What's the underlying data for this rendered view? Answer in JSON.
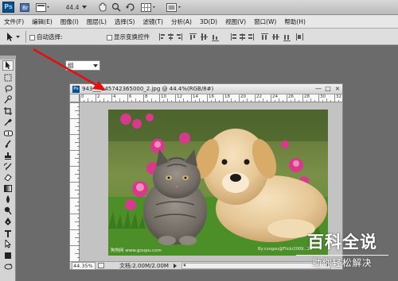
{
  "app": {
    "logo": "Ps"
  },
  "topbar": {
    "zoom_value": "44.4",
    "icons": [
      "bridge-icon",
      "mini-bridge-icon",
      "zoom-dropdown-icon",
      "hand-icon",
      "zoom-icon",
      "rotate-icon",
      "grid-icon",
      "screen-mode-icon"
    ]
  },
  "menus": [
    "文件(F)",
    "编辑(E)",
    "图像(I)",
    "图层(L)",
    "选择(S)",
    "滤镜(T)",
    "分析(A)",
    "3D(D)",
    "视图(V)",
    "窗口(W)",
    "帮助(H)"
  ],
  "options": {
    "auto_select_label": "自动选择:",
    "auto_select_checked": false,
    "layer_select_value": "组",
    "show_transform_label": "显示变换控件",
    "show_transform_checked": false
  },
  "tools": [
    "move-tool-icon",
    "marquee-tool-icon",
    "lasso-tool-icon",
    "quick-select-tool-icon",
    "crop-tool-icon",
    "eyedropper-tool-icon",
    "healing-brush-tool-icon",
    "brush-tool-icon",
    "clone-stamp-tool-icon",
    "history-brush-tool-icon",
    "eraser-tool-icon",
    "gradient-tool-icon",
    "blur-tool-icon",
    "dodge-tool-icon",
    "pen-tool-icon",
    "type-tool-icon",
    "path-selection-tool-icon",
    "shape-tool-icon",
    "3d-rotate-tool-icon"
  ],
  "document": {
    "title": "943___145742365000_2.jpg @ 44.4%(RGB/8#)",
    "ruler_numbers": [
      "0",
      "2",
      "4",
      "6",
      "8",
      "10",
      "12",
      "14",
      "16",
      "18",
      "20",
      "22",
      "24",
      "26",
      "28",
      "30",
      "32"
    ],
    "zoom_status": "44.35%",
    "doc_size": "文档:2.00M/2.00M",
    "photo_caption_left": "狗狗网 www.goupu.com",
    "photo_caption_right": "By:cungou@Flickr2009...2"
  },
  "watermark": {
    "main": "百科全说",
    "sub": "助你轻松解决"
  },
  "colors": {
    "annotation_arrow": "#e01010",
    "ps_blue": "#0b4f88"
  }
}
